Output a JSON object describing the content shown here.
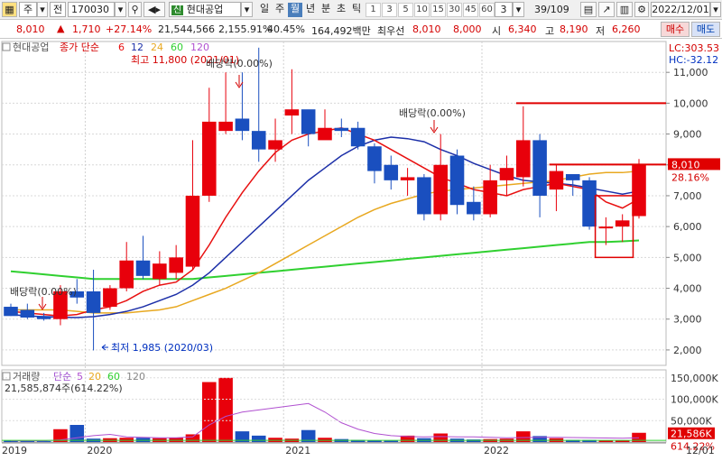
{
  "toolbar": {
    "tab_stock": "주",
    "tab_prev": "전",
    "code": "170030",
    "stock_name": "현대공업",
    "period_tabs": [
      "일",
      "주",
      "월",
      "년",
      "분",
      "초",
      "틱"
    ],
    "interval_buttons": [
      "1",
      "3",
      "5",
      "10",
      "15",
      "30",
      "45",
      "60"
    ],
    "interval_value": "3",
    "page_counter": "39/109",
    "date": "2022/12/01"
  },
  "quote": {
    "price": "8,010",
    "change": "1,710",
    "change_pct": "+27.14%",
    "volume": "21,544,566",
    "volume_pct": "2,155.91%",
    "rate": "40.45%",
    "amount": "164,492백만",
    "ask_label": "최우선",
    "ask": "8,010",
    "bid": "8,000",
    "open_label": "시",
    "open": "6,340",
    "high_label": "고",
    "high": "8,190",
    "low_label": "저",
    "low": "6,260",
    "buy_button": "매수",
    "sell_button": "매도"
  },
  "chart_data": {
    "type": "candlestick",
    "legend": {
      "stock": "현대공업",
      "series": "종가 단순",
      "ma": [
        "6",
        "12",
        "24",
        "60",
        "120"
      ]
    },
    "annotations": {
      "high": "최고 11,800 (2021/01)",
      "low": "최저 1,985 (2020/03)",
      "dividend": "배당락(0.00%)",
      "lc": "LC:303.53",
      "hc": "HC:-32.12",
      "price_tag": "8,010",
      "price_pct": "28.16%"
    },
    "ylim": [
      1500,
      12000
    ],
    "yticks": [
      2000,
      3000,
      4000,
      5000,
      6000,
      7000,
      8000,
      9000,
      10000,
      11000
    ],
    "ytick_labels": [
      "2,000",
      "3,000",
      "4,000",
      "5,000",
      "6,000",
      "7,000",
      "8,000",
      "9,000",
      "10,000",
      "11,000"
    ],
    "x_labels": [
      "2019",
      "2020",
      "2021",
      "2022",
      "12/01"
    ],
    "candles": [
      {
        "o": 3400,
        "h": 3500,
        "l": 3100,
        "c": 3100
      },
      {
        "o": 3300,
        "h": 3500,
        "l": 3000,
        "c": 3050
      },
      {
        "o": 3100,
        "h": 3200,
        "l": 2950,
        "c": 3000
      },
      {
        "o": 3000,
        "h": 4100,
        "l": 2800,
        "c": 3900
      },
      {
        "o": 3900,
        "h": 4300,
        "l": 3500,
        "c": 3700
      },
      {
        "o": 3900,
        "h": 4600,
        "l": 1985,
        "c": 3200
      },
      {
        "o": 3400,
        "h": 4100,
        "l": 3300,
        "c": 4000
      },
      {
        "o": 4000,
        "h": 5500,
        "l": 3900,
        "c": 4900
      },
      {
        "o": 4900,
        "h": 5700,
        "l": 4300,
        "c": 4400
      },
      {
        "o": 4300,
        "h": 5200,
        "l": 4100,
        "c": 4800
      },
      {
        "o": 4500,
        "h": 5400,
        "l": 4300,
        "c": 5000
      },
      {
        "o": 4700,
        "h": 8800,
        "l": 4600,
        "c": 7000
      },
      {
        "o": 7000,
        "h": 10500,
        "l": 6800,
        "c": 9400
      },
      {
        "o": 9100,
        "h": 11000,
        "l": 9000,
        "c": 9400
      },
      {
        "o": 9500,
        "h": 11000,
        "l": 8800,
        "c": 9100
      },
      {
        "o": 9100,
        "h": 11800,
        "l": 8100,
        "c": 8500
      },
      {
        "o": 8500,
        "h": 9500,
        "l": 8100,
        "c": 8800
      },
      {
        "o": 9600,
        "h": 11100,
        "l": 9000,
        "c": 9800
      },
      {
        "o": 9800,
        "h": 9700,
        "l": 8600,
        "c": 9000
      },
      {
        "o": 8800,
        "h": 9800,
        "l": 8900,
        "c": 9200
      },
      {
        "o": 9200,
        "h": 9500,
        "l": 8900,
        "c": 9100
      },
      {
        "o": 9200,
        "h": 9400,
        "l": 8500,
        "c": 8600
      },
      {
        "o": 8600,
        "h": 8700,
        "l": 7400,
        "c": 7800
      },
      {
        "o": 8000,
        "h": 8300,
        "l": 7200,
        "c": 7500
      },
      {
        "o": 7500,
        "h": 7900,
        "l": 7000,
        "c": 7600
      },
      {
        "o": 7600,
        "h": 7700,
        "l": 6200,
        "c": 6400
      },
      {
        "o": 6400,
        "h": 9000,
        "l": 6200,
        "c": 8000
      },
      {
        "o": 8300,
        "h": 8500,
        "l": 6400,
        "c": 6700
      },
      {
        "o": 6800,
        "h": 7300,
        "l": 6200,
        "c": 6400
      },
      {
        "o": 6400,
        "h": 8000,
        "l": 6300,
        "c": 7500
      },
      {
        "o": 7500,
        "h": 8300,
        "l": 7000,
        "c": 7900
      },
      {
        "o": 7600,
        "h": 9900,
        "l": 7300,
        "c": 8800
      },
      {
        "o": 8800,
        "h": 9000,
        "l": 6300,
        "c": 7000
      },
      {
        "o": 7200,
        "h": 8000,
        "l": 6500,
        "c": 7800
      },
      {
        "o": 7700,
        "h": 7600,
        "l": 7000,
        "c": 7500
      },
      {
        "o": 7500,
        "h": 7600,
        "l": 5900,
        "c": 6000
      },
      {
        "o": 6000,
        "h": 6300,
        "l": 5400,
        "c": 6000
      },
      {
        "o": 6000,
        "h": 6400,
        "l": 5500,
        "c": 6200
      },
      {
        "o": 6340,
        "h": 8190,
        "l": 6260,
        "c": 8010
      }
    ],
    "ma6": [
      3250,
      3200,
      3150,
      3100,
      3150,
      3300,
      3400,
      3600,
      3900,
      4100,
      4200,
      4600,
      5400,
      6300,
      7100,
      7800,
      8400,
      8800,
      9000,
      9100,
      9200,
      9000,
      8800,
      8500,
      8200,
      7900,
      7600,
      7400,
      7200,
      7100,
      7000,
      7200,
      7300,
      7400,
      7300,
      7200,
      6800,
      6600,
      6900
    ],
    "ma12": [
      3150,
      3100,
      3080,
      3060,
      3050,
      3080,
      3150,
      3250,
      3400,
      3600,
      3800,
      4100,
      4500,
      5000,
      5500,
      6000,
      6500,
      7000,
      7500,
      7900,
      8300,
      8600,
      8800,
      8900,
      8850,
      8750,
      8500,
      8300,
      8050,
      7850,
      7650,
      7500,
      7450,
      7400,
      7350,
      7250,
      7150,
      7050,
      7150
    ],
    "ma24": [
      3300,
      3300,
      3300,
      3300,
      3250,
      3200,
      3200,
      3200,
      3250,
      3300,
      3400,
      3600,
      3800,
      4000,
      4250,
      4500,
      4800,
      5100,
      5400,
      5700,
      6000,
      6300,
      6550,
      6750,
      6900,
      7050,
      7150,
      7200,
      7250,
      7300,
      7350,
      7400,
      7450,
      7500,
      7600,
      7700,
      7750,
      7750,
      7800
    ],
    "ma60": [
      4550,
      4500,
      4450,
      4400,
      4350,
      4300,
      4300,
      4300,
      4300,
      4300,
      4300,
      4300,
      4350,
      4400,
      4450,
      4500,
      4550,
      4600,
      4650,
      4700,
      4750,
      4800,
      4850,
      4900,
      4950,
      5000,
      5050,
      5100,
      5150,
      5200,
      5250,
      5300,
      5350,
      5400,
      5450,
      5500,
      5500,
      5520,
      5550
    ],
    "resistance": [
      {
        "y": 10000,
        "from": 31,
        "to": 38
      },
      {
        "y": 8010,
        "from": 33,
        "to": 38
      }
    ],
    "volume_panel": {
      "legend": "거래량",
      "series": "단순",
      "ma": [
        "5",
        "20",
        "60",
        "120"
      ],
      "value_label": "21,585,874주(614.22%)",
      "yticks": [
        "150,000K",
        "100,000K",
        "50,000K"
      ],
      "last_tag": "21,586K",
      "last_pct": "614.22%",
      "max": 160000,
      "values": [
        3000,
        3000,
        2000,
        30000,
        40000,
        8000,
        9000,
        10000,
        10000,
        9000,
        10000,
        18000,
        140000,
        150000,
        25000,
        15000,
        10000,
        8000,
        28000,
        10000,
        7000,
        5000,
        4000,
        3000,
        15000,
        9000,
        20000,
        8000,
        6000,
        7000,
        8000,
        25000,
        14000,
        9000,
        5000,
        5000,
        4000,
        3500,
        21586
      ],
      "ma5": [
        3000,
        3000,
        3000,
        5000,
        10000,
        15000,
        18000,
        12000,
        11000,
        10000,
        10000,
        12000,
        40000,
        60000,
        70000,
        75000,
        80000,
        85000,
        90000,
        70000,
        45000,
        30000,
        20000,
        15000,
        13000,
        12000,
        13000,
        12000,
        12000,
        11000,
        10000,
        10500,
        11000,
        11000,
        10500,
        10000,
        9500,
        9000,
        10000
      ]
    }
  },
  "colors": {
    "up": "#e8000b",
    "down": "#1a4fbf",
    "ma6": "#e81010",
    "ma12": "#1c2fa8",
    "ma24": "#e8a820",
    "ma60": "#30d030",
    "ma120": "#b050d0"
  }
}
